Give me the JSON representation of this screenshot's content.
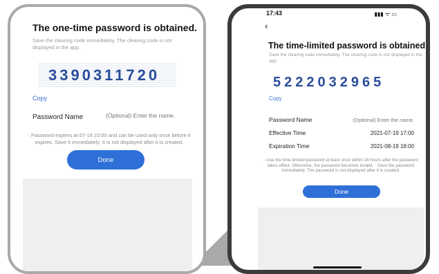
{
  "left": {
    "title": "The one-time password is obtained.",
    "description": "Save the clearing code immediately. The clearing code is not displayed in the app.",
    "code": "3390311720",
    "copy_label": "Copy",
    "password_name_label": "Password Name",
    "password_name_placeholder": "(Optional) Enter the name.",
    "note": "· Password expires at 07-19 23:00 and can be used only once before it expires. Save it immediately. It is not displayed after it is created.",
    "done_label": "Done"
  },
  "right": {
    "status_time": "17:43",
    "status_icons": "▮▮▮ ᯤ ▭",
    "back_icon": "‹",
    "title": "The time-limited password is obtained.",
    "description": "Save the clearing code immediately. The clearing code is not displayed in the app.",
    "code": "5222032965",
    "copy_label": "Copy",
    "password_name_label": "Password Name",
    "password_name_placeholder": "(Optional) Enter the name.",
    "effective_time_label": "Effective Time",
    "effective_time_value": "2021-07-19 17:00",
    "expiration_time_label": "Expiration Time",
    "expiration_time_value": "2021-08-19 18:00",
    "note": "· Use the time-limited password at least once within 24 hours after the password takes effect. Otherwise, the password becomes invalid. · Save the password immediately. The password is not displayed after it is created.",
    "done_label": "Done"
  },
  "colors": {
    "accent": "#2f6fd8",
    "code_color": "#2a4d9c",
    "link": "#3c6fd1"
  }
}
